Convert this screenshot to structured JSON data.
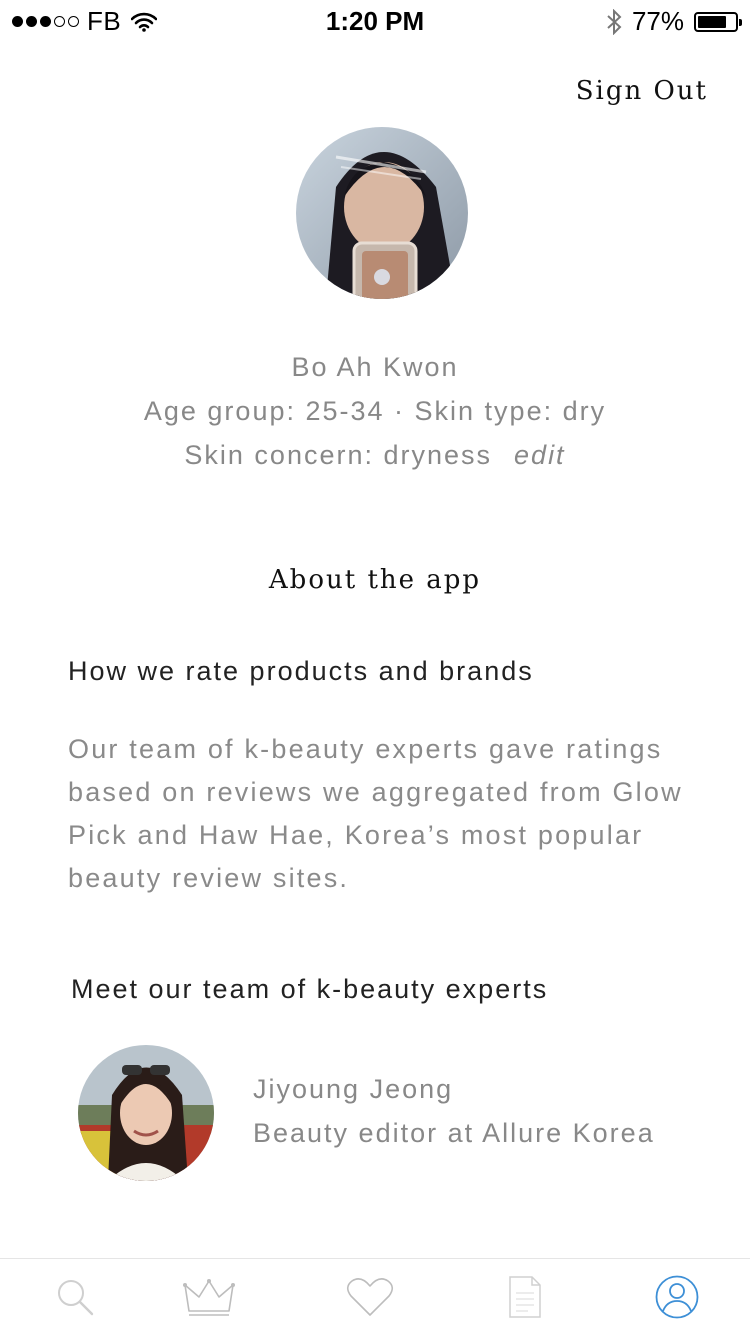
{
  "status_bar": {
    "carrier": "FB",
    "time": "1:20 PM",
    "battery_percent": "77%",
    "battery_level": 0.77,
    "signal_bars_filled": 3,
    "signal_bars_total": 5,
    "icons": [
      "wifi-icon",
      "bluetooth-icon",
      "battery-icon"
    ]
  },
  "header": {
    "sign_out_label": "Sign Out"
  },
  "profile": {
    "name": "Bo Ah Kwon",
    "details": "Age group: 25-34 · Skin type: dry",
    "concern": "Skin concern: dryness",
    "edit_label": "edit"
  },
  "about": {
    "title": "About the app",
    "rating_heading": "How we rate products and brands",
    "rating_body": "Our team of k-beauty experts gave ratings based on reviews we aggregated from Glow Pick and Haw Hae, Korea’s most popular beauty review sites.",
    "team_heading": "Meet our team of k-beauty experts"
  },
  "experts": [
    {
      "name": "Jiyoung Jeong",
      "title": "Beauty editor at Allure Korea"
    }
  ],
  "tab_bar": {
    "tabs": [
      {
        "icon": "search-icon",
        "active": false
      },
      {
        "icon": "crown-icon",
        "active": false
      },
      {
        "icon": "heart-icon",
        "active": false
      },
      {
        "icon": "document-icon",
        "active": false
      },
      {
        "icon": "profile-icon",
        "active": true
      }
    ],
    "colors": {
      "active": "#3d8fd6",
      "inactive": "#cfcfcf"
    }
  }
}
